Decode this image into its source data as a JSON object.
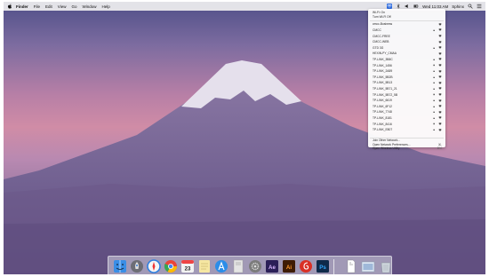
{
  "menubar": {
    "app_name": "Finder",
    "menus": [
      "File",
      "Edit",
      "View",
      "Go",
      "Window",
      "Help"
    ],
    "clock": "Wed 11:03 AM",
    "user": "Sphinx"
  },
  "wifi_menu": {
    "status": "Wi-Fi: On",
    "toggle_label": "Turn Wi-Fi Off",
    "networks": [
      {
        "name": "cmcc-Business",
        "locked": false
      },
      {
        "name": "CMCC",
        "locked": true
      },
      {
        "name": "CMCC-FREE",
        "locked": false
      },
      {
        "name": "CMCC-WEB",
        "locked": false
      },
      {
        "name": "GTD 3G",
        "locked": true
      },
      {
        "name": "HEXIN-PY_CMAA",
        "locked": false
      },
      {
        "name": "TP-LINK_3B8C",
        "locked": true
      },
      {
        "name": "TP-LINK_1456",
        "locked": true
      },
      {
        "name": "TP-LINK_2A89",
        "locked": true
      },
      {
        "name": "TP-LINK_5B2B",
        "locked": true
      },
      {
        "name": "TP-LINK_5B13",
        "locked": true
      },
      {
        "name": "TP-LINK_5B71_21",
        "locked": true
      },
      {
        "name": "TP-LINK_5B72_5B",
        "locked": true
      },
      {
        "name": "TP-LINK_6619",
        "locked": true
      },
      {
        "name": "TP-LINK_6F12",
        "locked": true
      },
      {
        "name": "TP-LINK_7748",
        "locked": true
      },
      {
        "name": "TP-LINK_8181",
        "locked": true
      },
      {
        "name": "TP-LINK_8416",
        "locked": true
      },
      {
        "name": "TP-LINK_E807",
        "locked": true
      }
    ],
    "other_network": "Join Other Network...",
    "open_prefs": "Open Network Preferences...",
    "prefs_shortcut": "⌘,",
    "diagnostics": "Open Wireless Utility",
    "diagnostics_shortcut": "⌘U"
  },
  "dock": {
    "apps": [
      {
        "id": "finder",
        "icon": "finder-icon",
        "color": "#3a8ee6"
      },
      {
        "id": "launchpad",
        "icon": "rocket-icon",
        "color": "#6d6d75"
      },
      {
        "id": "safari",
        "icon": "compass-icon",
        "color": "#2f7fe0"
      },
      {
        "id": "chrome",
        "icon": "chrome-icon",
        "color": "#e9453a"
      },
      {
        "id": "calendar",
        "icon": "calendar-icon",
        "color": "#f2f2f2",
        "label": "23"
      },
      {
        "id": "notes",
        "icon": "notes-icon",
        "color": "#f6e7a2"
      },
      {
        "id": "appstore",
        "icon": "app-store-icon",
        "color": "#2c8de8"
      },
      {
        "id": "preview",
        "icon": "preview-icon",
        "color": "#e4e4e4"
      },
      {
        "id": "sysprefs",
        "icon": "gear-icon",
        "color": "#7b7b7b"
      },
      {
        "id": "aftereffects",
        "icon": "ae-icon",
        "color": "#2b1f58",
        "label": "Ae"
      },
      {
        "id": "illustrator",
        "icon": "ai-icon",
        "color": "#3f1c05",
        "label": "Ai"
      },
      {
        "id": "netease",
        "icon": "music-icon",
        "color": "#d93025"
      },
      {
        "id": "photoshop",
        "icon": "ps-icon",
        "color": "#0e2a4a",
        "label": "Ps"
      },
      {
        "id": "document",
        "icon": "document-icon",
        "color": "#ffffff"
      },
      {
        "id": "screenshot",
        "icon": "screenshot-icon",
        "color": "#dde6f2"
      },
      {
        "id": "trash",
        "icon": "trash-icon",
        "color": "#cfd6dd"
      }
    ]
  }
}
